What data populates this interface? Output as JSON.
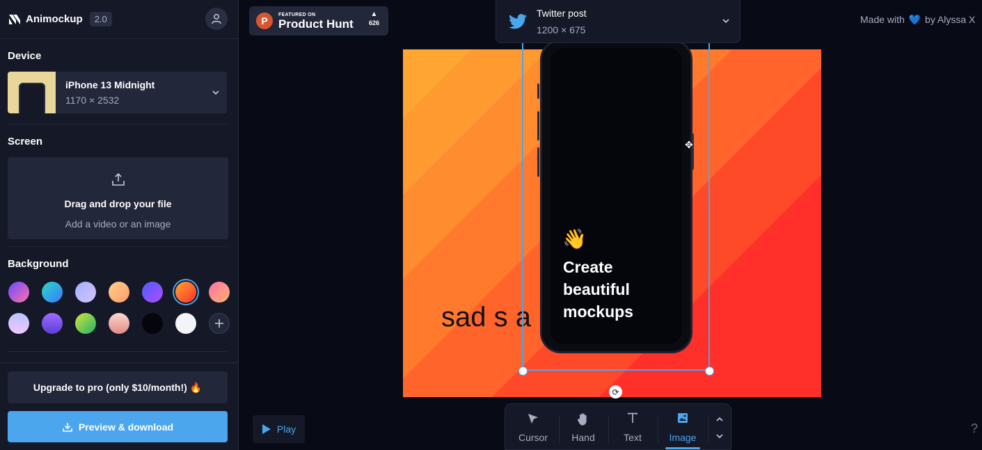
{
  "app": {
    "name": "Animockup",
    "version": "2.0"
  },
  "sidebar": {
    "device_title": "Device",
    "device": {
      "name": "iPhone 13 Midnight",
      "size": "1170 × 2532"
    },
    "screen_title": "Screen",
    "dropzone": {
      "title": "Drag and drop your file",
      "subtitle": "Add a video or an image"
    },
    "background_title": "Background",
    "backgrounds": [
      {
        "name": "purple-pink",
        "css": "linear-gradient(135deg,#6a4cff,#ff6fa8)"
      },
      {
        "name": "cyan-blue",
        "css": "linear-gradient(135deg,#2bd6c6,#3a7bff)"
      },
      {
        "name": "lavender",
        "css": "linear-gradient(135deg,#9fb0ff,#d6c3ff)"
      },
      {
        "name": "peach",
        "css": "linear-gradient(135deg,#ffd08a,#ff9b6b)"
      },
      {
        "name": "violet",
        "css": "linear-gradient(135deg,#4d5cff,#b04dff)"
      },
      {
        "name": "orange-red",
        "css": "linear-gradient(135deg,#ffa632,#ff2f29)",
        "selected": true
      },
      {
        "name": "pink-orange",
        "css": "linear-gradient(135deg,#ff6fa8,#ffb56b)"
      },
      {
        "name": "pastel",
        "css": "linear-gradient(180deg,#b6c4ff,#f2c6ff)"
      },
      {
        "name": "purple-stripes",
        "css": "linear-gradient(180deg,#a06bff,#5b3ed6)"
      },
      {
        "name": "lime",
        "css": "linear-gradient(135deg,#d7e339,#1bb56b)"
      },
      {
        "name": "rose",
        "css": "linear-gradient(180deg,#ffd7cf,#e08b86)"
      },
      {
        "name": "black",
        "css": "#05060c"
      },
      {
        "name": "white",
        "css": "#f3f4f8"
      }
    ],
    "upgrade_label": "Upgrade to pro (only $10/month!) 🔥",
    "download_label": "Preview & download"
  },
  "product_hunt": {
    "featured": "FEATURED ON",
    "name": "Product Hunt",
    "votes": "626"
  },
  "format": {
    "name": "Twitter post",
    "size": "1200 × 675"
  },
  "credit": {
    "prefix": "Made with",
    "heart": "💙",
    "suffix": "by Alyssa X"
  },
  "canvas": {
    "overlay_text": "sad s a",
    "phone_emoji": "👋",
    "phone_headline": "Create beautiful mockups"
  },
  "playback": {
    "play_label": "Play"
  },
  "tools": [
    {
      "id": "cursor",
      "label": "Cursor",
      "active": false
    },
    {
      "id": "hand",
      "label": "Hand",
      "active": false
    },
    {
      "id": "text",
      "label": "Text",
      "active": false
    },
    {
      "id": "image",
      "label": "Image",
      "active": true
    }
  ],
  "help_label": "?",
  "colors": {
    "accent": "#4ba6ee",
    "sidebar": "#151827",
    "app_bg": "#080b16"
  }
}
